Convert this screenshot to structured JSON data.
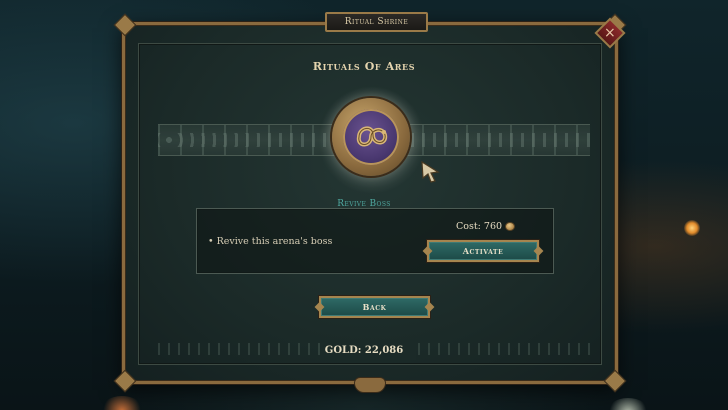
{
  "window": {
    "title": "Ritual Shrine",
    "close_symbol": "×"
  },
  "heading": "Rituals Of Ares",
  "medallion": {
    "icon": "ouroboros-icon"
  },
  "section": {
    "label": "Revive Boss",
    "description": "• Revive this arena's boss",
    "cost_text": "Cost: 760",
    "cost_icon": "gold-coin-icon",
    "activate_label": "Activate"
  },
  "back_label": "Back",
  "gold_text": "GOLD:  22,086",
  "colors": {
    "frame_gold": "#9a7a48",
    "button_teal": "#2f6a66",
    "section_label_teal": "#4fa8a0",
    "medallion_purple": "#4a3870"
  }
}
